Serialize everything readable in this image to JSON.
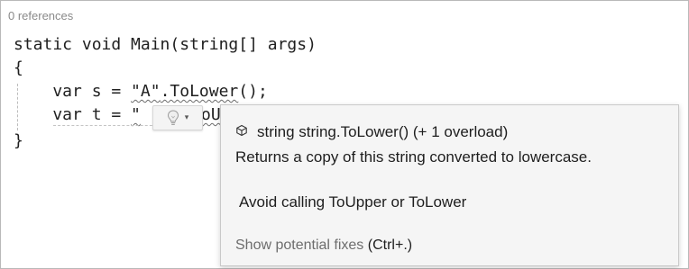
{
  "codelens": {
    "references": "0 references"
  },
  "code": {
    "line1": "static void Main(string[] args)",
    "line2": "{",
    "line3_prefix": "    var s = ",
    "line3_str": "\"A\"",
    "line3_call": ".ToLower",
    "line3_suffix": "();",
    "line4_prefix": "    var t = ",
    "line4_str_start": "\"",
    "line4_tail": "oU",
    "line5": "}"
  },
  "lightbulb": {
    "icon": "lightbulb-icon",
    "dropdown_glyph": "▾"
  },
  "tooltip": {
    "signature_icon": "method-cube-icon",
    "signature": "string string.ToLower() (+ 1 overload)",
    "description": "Returns a copy of this string converted to lowercase.",
    "rule_message": "Avoid calling ToUpper or ToLower",
    "fixes_label": "Show potential fixes",
    "fixes_shortcut": "(Ctrl+.)"
  }
}
